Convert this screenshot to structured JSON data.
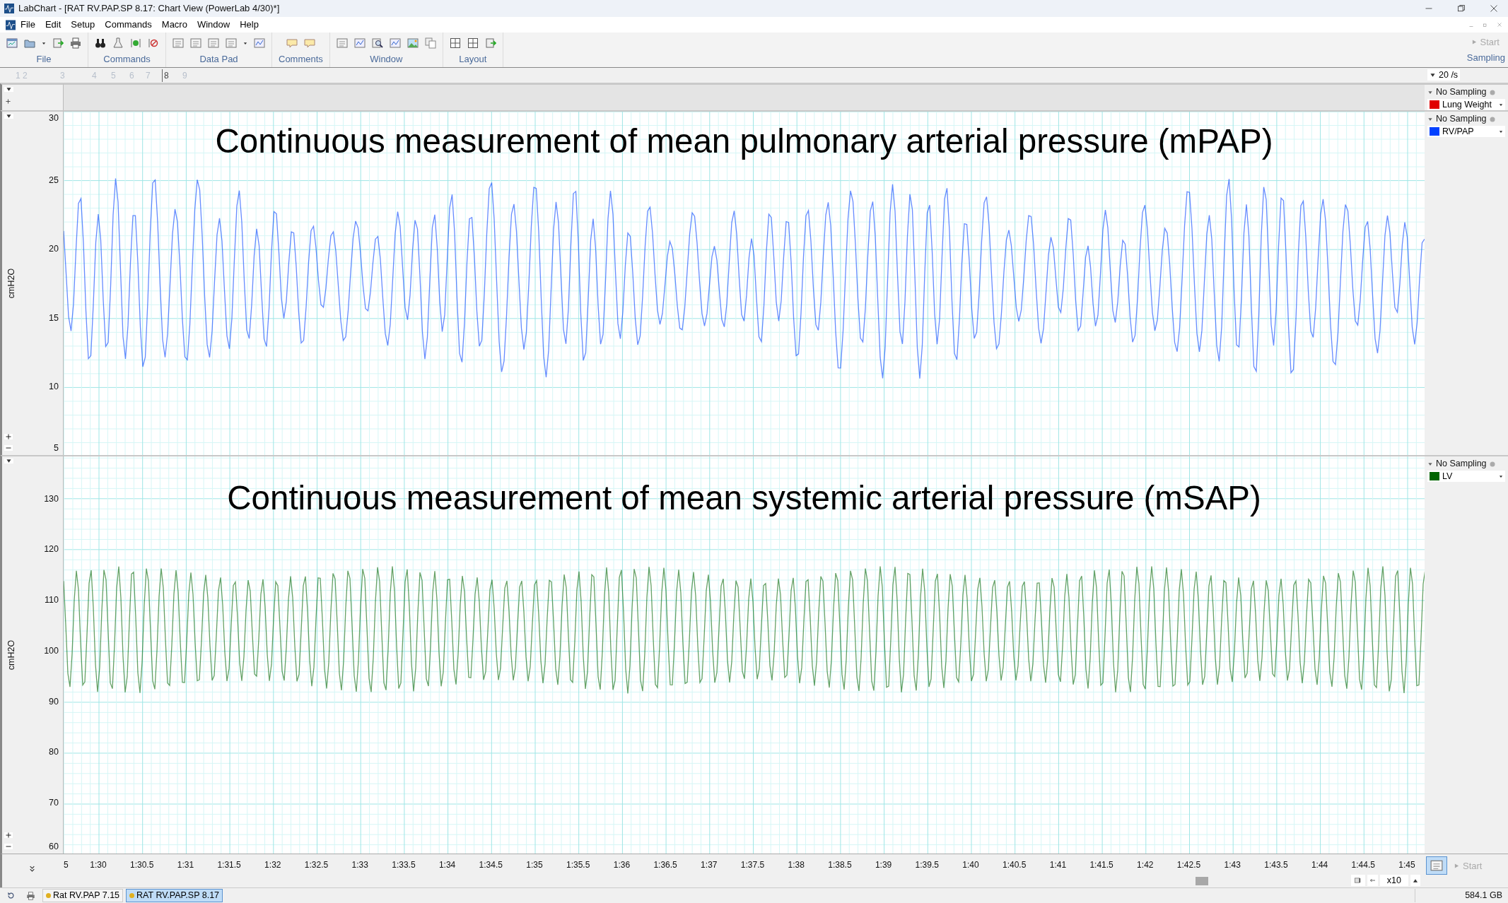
{
  "window": {
    "title": "LabChart - [RAT RV.PAP.SP 8.17: Chart View (PowerLab 4/30)*]"
  },
  "menu": [
    "File",
    "Edit",
    "Setup",
    "Commands",
    "Macro",
    "Window",
    "Help"
  ],
  "toolbar": {
    "groups": [
      {
        "label": "File"
      },
      {
        "label": "Commands"
      },
      {
        "label": "Data Pad"
      },
      {
        "label": "Comments"
      },
      {
        "label": "Window"
      },
      {
        "label": "Layout"
      }
    ],
    "sampling": {
      "label": "Sampling",
      "start": "Start",
      "disabled": true
    }
  },
  "ruler": {
    "markers": [
      {
        "label": "1 2",
        "selected": false
      },
      {
        "label": "3",
        "selected": false
      },
      {
        "label": "4",
        "selected": false
      },
      {
        "label": "5",
        "selected": false
      },
      {
        "label": "6",
        "selected": false
      },
      {
        "label": "7",
        "selected": false
      },
      {
        "label": "8",
        "selected": true
      },
      {
        "label": "9",
        "selected": false
      }
    ],
    "rate": "20 /s"
  },
  "channels": [
    {
      "kind": "strip",
      "status": "No Sampling",
      "name": "Lung Weight",
      "color": "#e00000"
    },
    {
      "kind": "chart",
      "status": "No Sampling",
      "name": "RV/PAP",
      "color": "#0040ff",
      "unit": "cmH2O",
      "title": "Continuous measurement of mean pulmonary arterial pressure (mPAP)",
      "yticks": [
        "30",
        "25",
        "20",
        "15",
        "10",
        "5"
      ]
    },
    {
      "kind": "chart",
      "status": "No Sampling",
      "name": "LV",
      "color": "#006400",
      "unit": "cmH2O",
      "title": "Continuous measurement of mean systemic arterial pressure (mSAP)",
      "yticks": [
        "130",
        "120",
        "110",
        "100",
        "90",
        "80",
        "70",
        "60"
      ]
    }
  ],
  "time_axis": {
    "ticks": [
      "5",
      "1:30",
      "1:30.5",
      "1:31",
      "1:31.5",
      "1:32",
      "1:32.5",
      "1:33",
      "1:33.5",
      "1:34",
      "1:34.5",
      "1:35",
      "1:35.5",
      "1:36",
      "1:36.5",
      "1:37",
      "1:37.5",
      "1:38",
      "1:38.5",
      "1:39",
      "1:39.5",
      "1:40",
      "1:40.5",
      "1:41",
      "1:41.5",
      "1:42",
      "1:42.5",
      "1:43",
      "1:43.5",
      "1:44",
      "1:44.5",
      "1:45"
    ]
  },
  "zoom": "x10",
  "start_button": {
    "label": "Start",
    "disabled": true
  },
  "documents": [
    {
      "label": "Rat RV.PAP 7.15",
      "selected": false
    },
    {
      "label": "RAT RV.PAP.SP 8.17",
      "selected": true
    }
  ],
  "status_bar": {
    "disk": "584.1 GB"
  }
}
